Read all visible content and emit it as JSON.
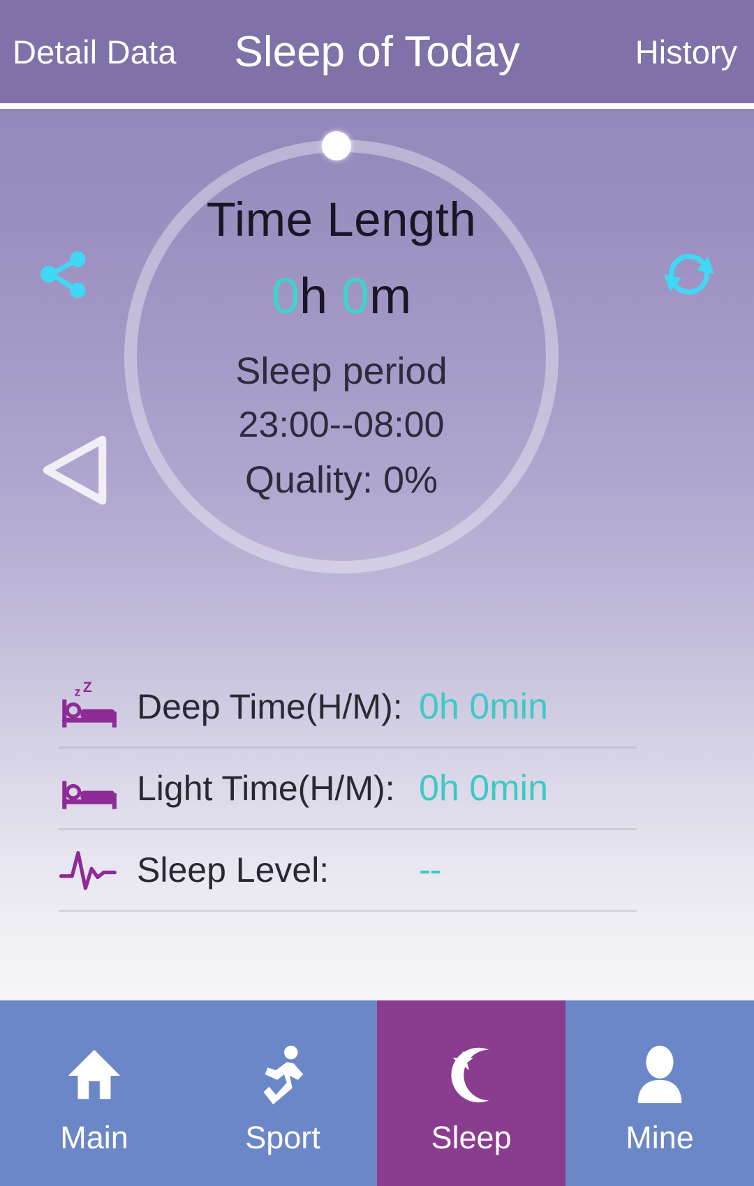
{
  "header": {
    "left_action": "Detail Data",
    "title": "Sleep of Today",
    "right_action": "History"
  },
  "icons": {
    "share": "share-icon",
    "refresh": "refresh-icon",
    "previous": "previous-day-arrow-icon"
  },
  "gauge": {
    "title": "Time Length",
    "hours": "0",
    "hours_unit": "h",
    "minutes": "0",
    "minutes_unit": "m",
    "sleep_period_label": "Sleep period",
    "sleep_period_range": "23:00--08:00",
    "quality": "Quality: 0%"
  },
  "stats": [
    {
      "icon": "bed-sleeping-zz-icon",
      "label": "Deep Time(H/M):",
      "value": "0h 0min"
    },
    {
      "icon": "bed-icon",
      "label": "Light Time(H/M):",
      "value": "0h 0min"
    },
    {
      "icon": "pulse-waveform-icon",
      "label": "Sleep Level:",
      "value": "--"
    }
  ],
  "nav": [
    {
      "icon": "home-icon",
      "label": "Main",
      "active": false
    },
    {
      "icon": "runner-icon",
      "label": "Sport",
      "active": false
    },
    {
      "icon": "moon-star-icon",
      "label": "Sleep",
      "active": true
    },
    {
      "icon": "person-icon",
      "label": "Mine",
      "active": false
    }
  ],
  "colors": {
    "header_purple": "#8071a8",
    "accent_teal": "#3fd3cb",
    "icon_cyan": "#40d8f5",
    "stat_icon_purple": "#8e2b96",
    "nav_inactive": "#6b87c7",
    "nav_active": "#8a3c8e"
  }
}
